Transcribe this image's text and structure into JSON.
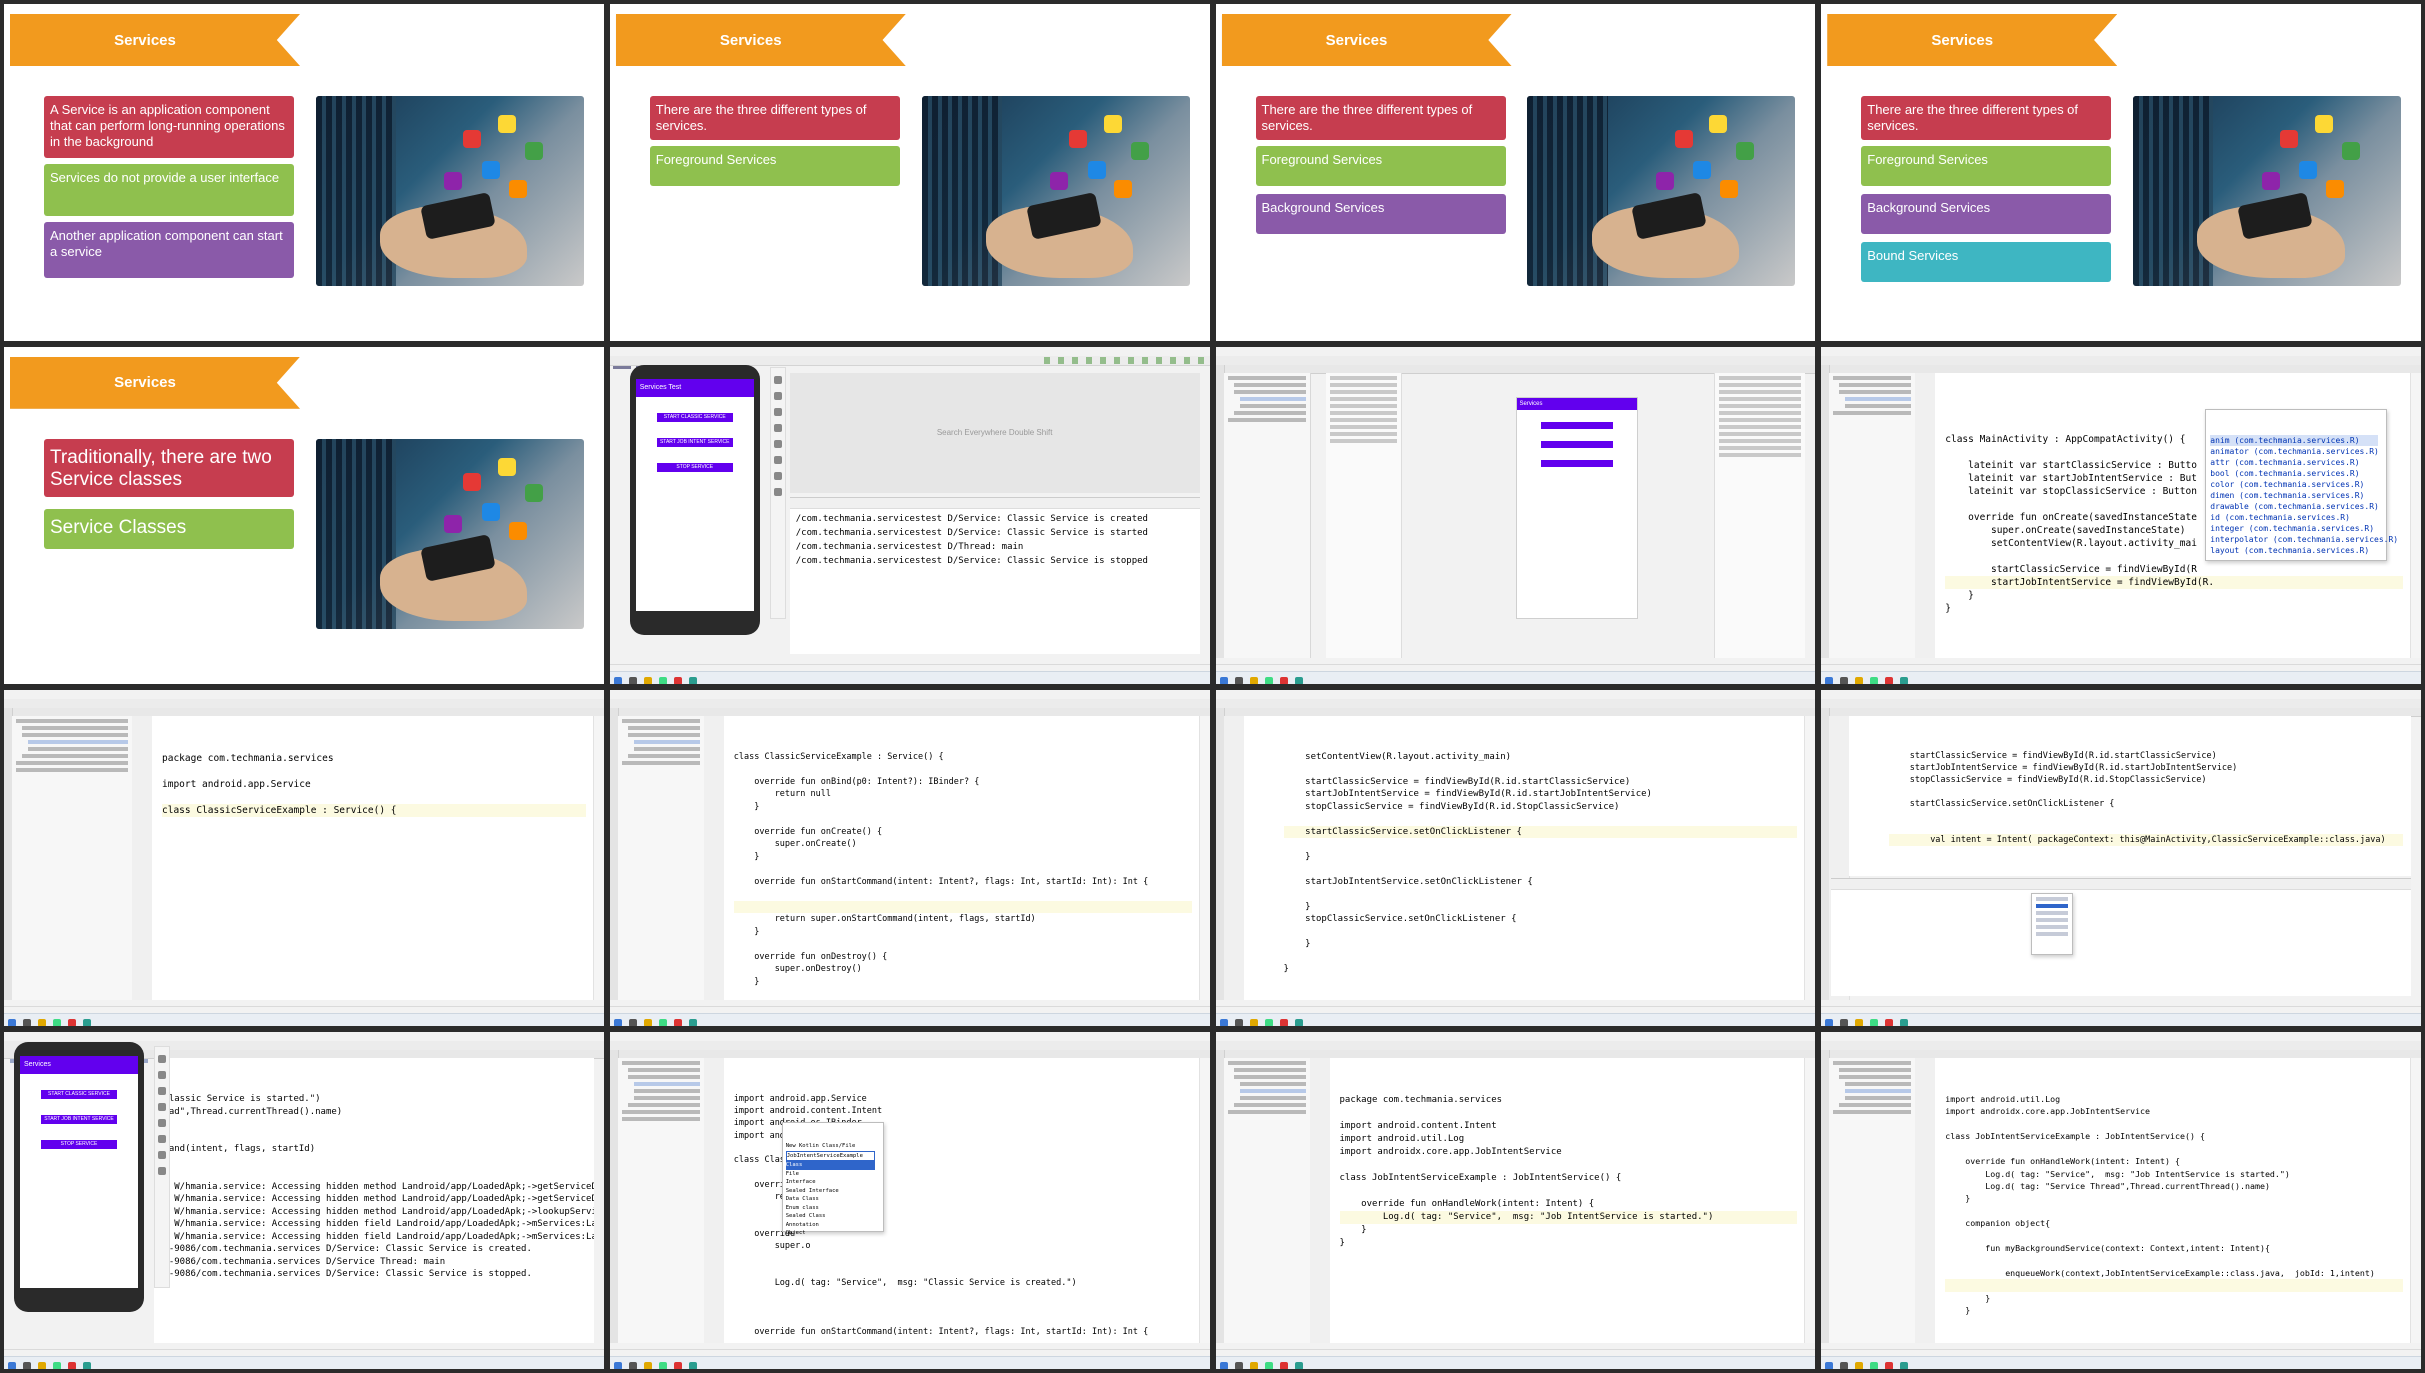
{
  "slides": {
    "title": "Services",
    "s1": {
      "items": [
        {
          "text": "A Service is an application component that can perform long-running operations in the background",
          "color": "#c63d4f"
        },
        {
          "text": "Services do not provide a user interface",
          "color": "#8fc04e"
        },
        {
          "text": "Another application component can start a service",
          "color": "#8a5aa9"
        }
      ]
    },
    "s2": {
      "items": [
        {
          "text": "There are the three different types of services.",
          "color": "#c63d4f"
        },
        {
          "text": "Foreground Services",
          "color": "#8fc04e"
        }
      ]
    },
    "s3": {
      "items": [
        {
          "text": "There are the three different types of services.",
          "color": "#c63d4f"
        },
        {
          "text": "Foreground Services",
          "color": "#8fc04e"
        },
        {
          "text": "Background Services",
          "color": "#8a5aa9"
        }
      ]
    },
    "s4": {
      "items": [
        {
          "text": "There are the three different types of services.",
          "color": "#c63d4f"
        },
        {
          "text": "Foreground Services",
          "color": "#8fc04e"
        },
        {
          "text": "Background Services",
          "color": "#8a5aa9"
        },
        {
          "text": "Bound Services",
          "color": "#3eb6c2"
        }
      ]
    },
    "s5": {
      "items": [
        {
          "text": "Traditionally, there are two Service classes",
          "color": "#c63d4f"
        },
        {
          "text": "Service Classes",
          "color": "#8fc04e"
        }
      ]
    }
  },
  "ide": {
    "emulator": {
      "app_title_1": "Services Test",
      "app_title_2": "Services",
      "buttons": [
        "START CLASSIC SERVICE",
        "START JOB INTENT SERVICE",
        "STOP SERVICE"
      ]
    },
    "search_hint": "Search Everywhere Double Shift",
    "logcat_1": [
      "/com.techmania.servicestest D/Service: Classic Service is created",
      "/com.techmania.servicestest D/Service: Classic Service is started",
      "/com.techmania.servicestest D/Thread: main",
      "/com.techmania.servicestest D/Service: Classic Service is stopped"
    ],
    "main_activity": [
      "class MainActivity : AppCompatActivity() {",
      "",
      "    lateinit var startClassicService : Butto",
      "    lateinit var startJobIntentService : But",
      "    lateinit var stopClassicService : Button",
      "",
      "    override fun onCreate(savedInstanceState",
      "        super.onCreate(savedInstanceState)",
      "        setContentView(R.layout.activity_mai",
      "",
      "        startClassicService = findViewById(R",
      "        startJobIntentService = findViewById(R.",
      "    }",
      "}"
    ],
    "autocomplete": [
      "anim (com.techmania.services.R)",
      "animator (com.techmania.services.R)",
      "attr (com.techmania.services.R)",
      "bool (com.techmania.services.R)",
      "color (com.techmania.services.R)",
      "dimen (com.techmania.services.R)",
      "drawable (com.techmania.services.R)",
      "id (com.techmania.services.R)",
      "integer (com.techmania.services.R)",
      "interpolator (com.techmania.services.R)",
      "layout (com.techmania.services.R)"
    ],
    "classic_header": [
      "package com.techmania.services",
      "",
      "import android.app.Service",
      "",
      "class ClassicServiceExample : Service() {"
    ],
    "classic_body": [
      "class ClassicServiceExample : Service() {",
      "",
      "    override fun onBind(p0: Intent?): IBinder? {",
      "        return null",
      "    }",
      "",
      "    override fun onCreate() {",
      "        super.onCreate()",
      "    }",
      "",
      "    override fun onStartCommand(intent: Intent?, flags: Int, startId: Int): Int {",
      "",
      "",
      "        return super.onStartCommand(intent, flags, startId)",
      "    }",
      "",
      "    override fun onDestroy() {",
      "        super.onDestroy()",
      "    }"
    ],
    "listeners": [
      "    setContentView(R.layout.activity_main)",
      "",
      "    startClassicService = findViewById(R.id.startClassicService)",
      "    startJobIntentService = findViewById(R.id.startJobIntentService)",
      "    stopClassicService = findViewById(R.id.StopClassicService)",
      "",
      "    startClassicService.setOnClickListener {",
      "",
      "    }",
      "",
      "    startJobIntentService.setOnClickListener {",
      "",
      "    }",
      "    stopClassicService.setOnClickListener {",
      "",
      "    }",
      "",
      "}"
    ],
    "intent_code": [
      "    startClassicService = findViewById(R.id.startClassicService)",
      "    startJobIntentService = findViewById(R.id.startJobIntentService)",
      "    stopClassicService = findViewById(R.id.StopClassicService)",
      "",
      "    startClassicService.setOnClickListener {",
      "",
      "",
      "        val intent = Intent( packageContext: this@MainActivity,ClassicServiceExample::class.java)"
    ],
    "logcat_2": [
      "\"Classic Service is started.\")",
      "read\",Thread.currentThread().name)",
      "",
      "",
      "mmand(intent, flags, startId)",
      "",
      "",
      "/? W/hmania.service: Accessing hidden method Landroid/app/LoadedApk;->getServiceDisp",
      "/? W/hmania.service: Accessing hidden method Landroid/app/LoadedApk;->getServiceDisp",
      "/? W/hmania.service: Accessing hidden method Landroid/app/LoadedApk;->lookupService",
      "/? W/hmania.service: Accessing hidden field Landroid/app/LoadedApk;->mServices:Landr",
      "/? W/hmania.service: Accessing hidden field Landroid/app/LoadedApk;->mServices:Landr",
      "06-9086/com.techmania.services D/Service: Classic Service is created.",
      "06-9086/com.techmania.services D/Service Thread: main",
      "06-9086/com.techmania.services D/Service: Classic Service is stopped."
    ],
    "imports": [
      "import android.app.Service",
      "import android.content.Intent",
      "import android.os.IBinder",
      "import android.util.Log",
      "",
      "class ClassicS",
      "",
      "    override",
      "        return",
      "",
      "",
      "    override",
      "        super.o",
      "",
      "",
      "        Log.d( tag: \"Service\",  msg: \"Classic Service is created.\")",
      "",
      "",
      "",
      "    override fun onStartCommand(intent: Intent?, flags: Int, startId: Int): Int {"
    ],
    "new_file_menu": [
      "New Kotlin Class/File",
      "JobIntentServiceExample",
      "Class",
      "File",
      "Interface",
      "Sealed Interface",
      "Data Class",
      "Enum class",
      "Sealed Class",
      "Annotation",
      "Object"
    ],
    "job_intent_1": [
      "package com.techmania.services",
      "",
      "import android.content.Intent",
      "import android.util.Log",
      "import androidx.core.app.JobIntentService",
      "",
      "class JobIntentServiceExample : JobIntentService() {",
      "",
      "    override fun onHandleWork(intent: Intent) {",
      "        Log.d( tag: \"Service\",  msg: \"Job IntentService is started.\")",
      "    }",
      "}"
    ],
    "job_intent_2": [
      "import android.util.Log",
      "import androidx.core.app.JobIntentService",
      "",
      "class JobIntentServiceExample : JobIntentService() {",
      "",
      "    override fun onHandleWork(intent: Intent) {",
      "        Log.d( tag: \"Service\",  msg: \"Job IntentService is started.\")",
      "        Log.d( tag: \"Service Thread\",Thread.currentThread().name)",
      "    }",
      "",
      "    companion object{",
      "",
      "        fun myBackgroundService(context: Context,intent: Intent){",
      "",
      "            enqueueWork(context,JobIntentServiceExample::class.java,  jobId: 1,intent)",
      "",
      "        }",
      "    }"
    ]
  }
}
